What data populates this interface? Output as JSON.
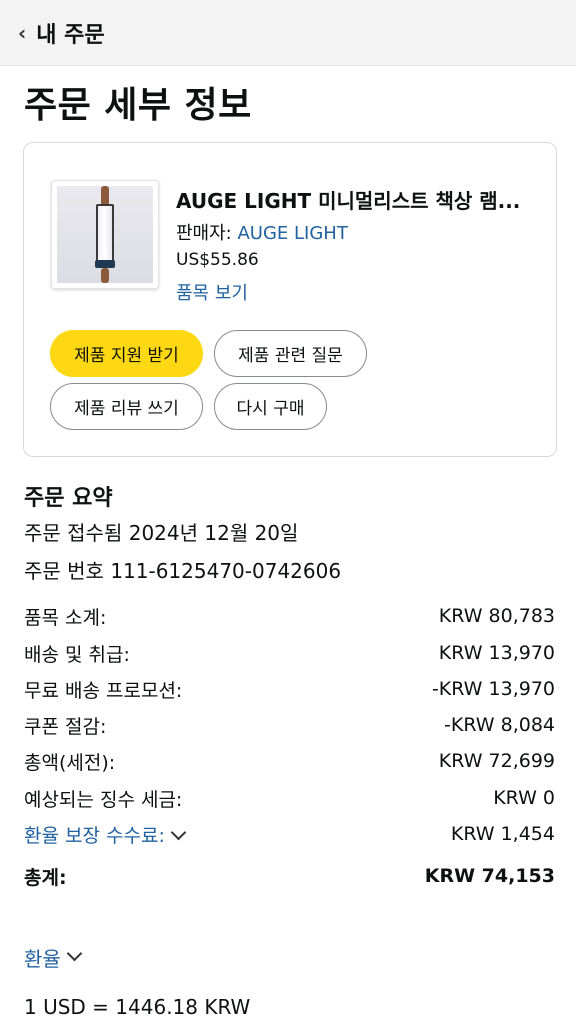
{
  "topbar": {
    "back_icon": "chevron-left-icon",
    "title": "내 주문"
  },
  "page_title": "주문 세부 정보",
  "product": {
    "name": "AUGE LIGHT 미니멀리스트 책상 램...",
    "seller_prefix": "판매자: ",
    "seller_name": "AUGE LIGHT",
    "price": "US$55.86",
    "view_item": "품목 보기"
  },
  "buttons": {
    "support": "제품 지원 받기",
    "question": "제품 관련 질문",
    "review": "제품 리뷰 쓰기",
    "rebuy": "다시 구매"
  },
  "summary": {
    "title": "주문 요약",
    "placed": "주문 접수됨 2024년 12월 20일",
    "order_number": "주문 번호 111-6125470-0742606",
    "rows": [
      {
        "label": "품목 소계:",
        "amount": "KRW 80,783"
      },
      {
        "label": "배송 및 취급:",
        "amount": "KRW 13,970"
      },
      {
        "label": "무료 배송 프로모션:",
        "amount": "-KRW 13,970"
      },
      {
        "label": "쿠폰 절감:",
        "amount": "-KRW 8,084"
      },
      {
        "label": "총액(세전):",
        "amount": "KRW 72,699"
      },
      {
        "label": "예상되는 징수 세금:",
        "amount": "KRW 0"
      },
      {
        "label": "환율 보장 수수료:",
        "amount": "KRW 1,454"
      },
      {
        "label": "총계:",
        "amount": "KRW 74,153"
      }
    ]
  },
  "exchange": {
    "toggle_label": "환율",
    "rate": "1 USD = 1446.18 KRW"
  },
  "colors": {
    "link": "#2162a1",
    "primary_button": "#ffd814",
    "topbar_bg": "#f3f3f3"
  }
}
